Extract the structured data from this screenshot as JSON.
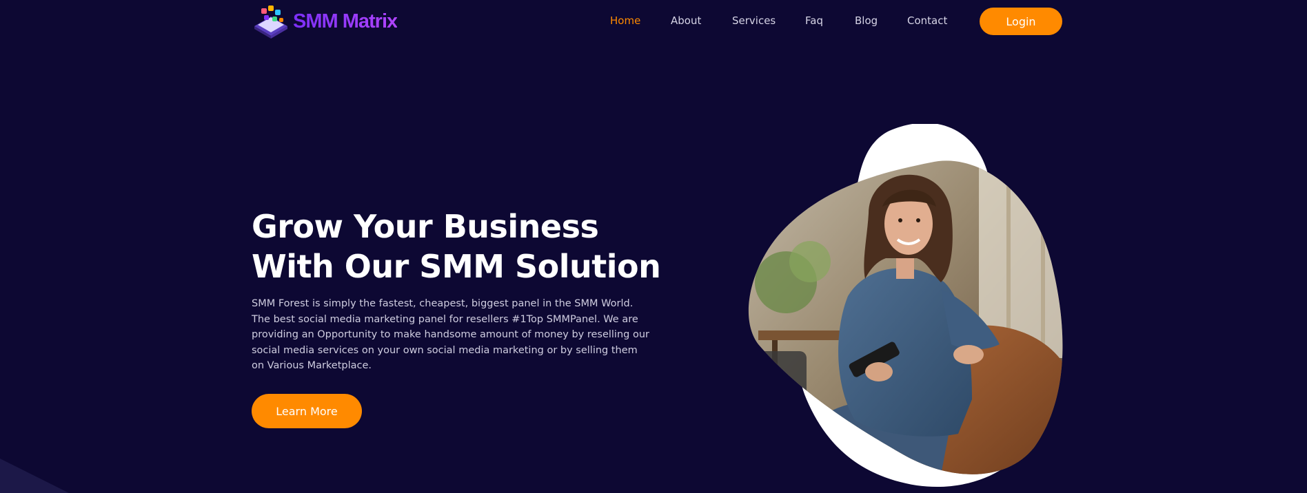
{
  "brand": {
    "name": "SMM Matrix",
    "logo_icon": "phone-apps-logo-icon"
  },
  "nav": {
    "items": [
      {
        "label": "Home",
        "active": true
      },
      {
        "label": "About",
        "active": false
      },
      {
        "label": "Services",
        "active": false
      },
      {
        "label": "Faq",
        "active": false
      },
      {
        "label": "Blog",
        "active": false
      },
      {
        "label": "Contact",
        "active": false
      }
    ],
    "login_label": "Login"
  },
  "hero": {
    "title_line1": "Grow Your Business",
    "title_line2": "With Our SMM Solution",
    "description": "SMM Forest is simply the fastest, cheapest, biggest panel in the SMM World. The best social media marketing panel for resellers #1Top SMMPanel. We are providing an Opportunity to make handsome amount of money by reselling our social media services on your own social media marketing or by selling them on Various Marketplace.",
    "cta_label": "Learn More",
    "image": "smiling-woman-holding-phone-photo"
  },
  "colors": {
    "background": "#0d0833",
    "accent": "#ff8a00",
    "brand": "#8a2be2",
    "text": "#ffffff",
    "muted_text": "#cfcde0"
  }
}
